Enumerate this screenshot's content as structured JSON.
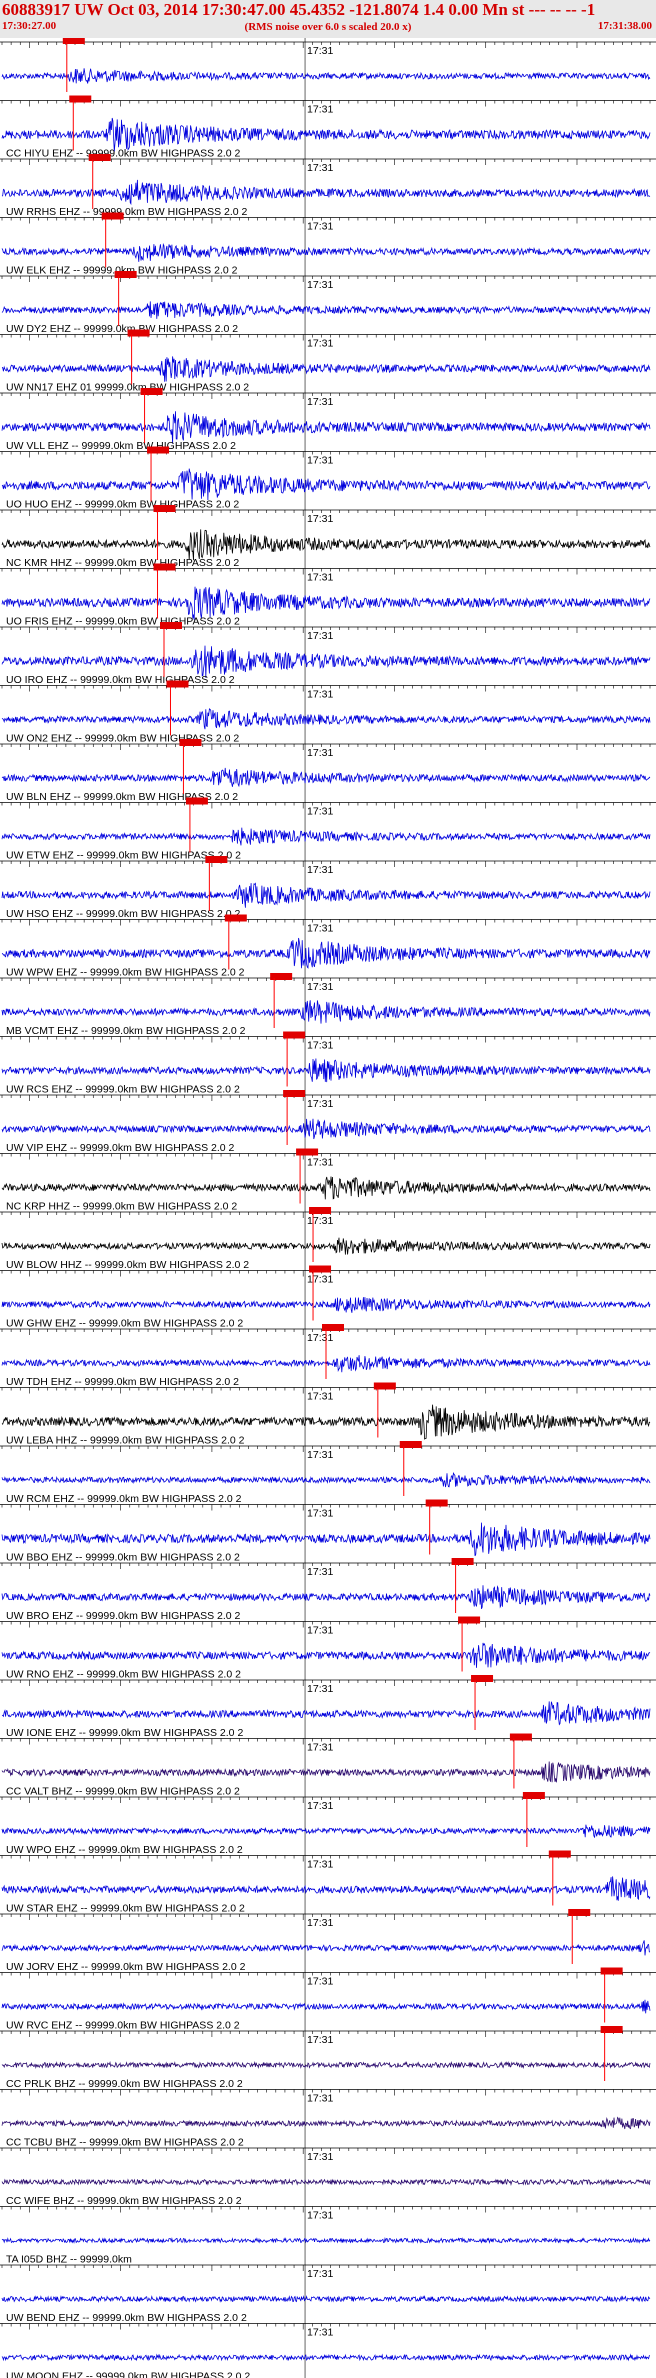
{
  "header": {
    "title": "60883917 UW Oct 03, 2014 17:30:47.00   45.4352 -121.8074  1.4 0.00 Mn st --- -- --  -1",
    "start_time": "17:30:27.00",
    "scale_note": "(RMS noise over 6.0 s scaled 20.0 x)",
    "end_time": "17:31:38.00"
  },
  "minute_label": "17:31",
  "colors": {
    "header_text": "#d40000",
    "header_bg": "#e8e8e8",
    "pick_line": "#ff0000",
    "pick_box": "#e00000"
  },
  "traces": [
    {
      "label": "",
      "color": "#0000dd",
      "burst": 0.1,
      "amp": 0.35
    },
    {
      "label": "CC HIYU EHZ -- 99999.0km BW  HIGHPASS  2.0  2",
      "color": "#0000dd",
      "burst": 0.16,
      "amp": 0.9
    },
    {
      "label": "UW RRHS EHZ -- 99999.0km BW  HIGHPASS  2.0  2",
      "color": "#0000dd",
      "burst": 0.18,
      "amp": 0.7
    },
    {
      "label": "UW ELK EHZ -- 99999.0km BW  HIGHPASS  2.0  2",
      "color": "#0000dd",
      "burst": 0.2,
      "amp": 0.45
    },
    {
      "label": "UW DY2 EHZ -- 99999.0km BW  HIGHPASS  2.0  2",
      "color": "#0000dd",
      "burst": 0.22,
      "amp": 0.45
    },
    {
      "label": "UW NN17 EHZ 01 99999.0km BW  HIGHPASS  2.0  2",
      "color": "#0000dd",
      "burst": 0.24,
      "amp": 0.6
    },
    {
      "label": "UW VLL EHZ -- 99999.0km BW  HIGHPASS  2.0  2",
      "color": "#0000dd",
      "burst": 0.25,
      "amp": 0.8
    },
    {
      "label": "UO HUO EHZ -- 99999.0km BW  HIGHPASS  2.0  2",
      "color": "#0000dd",
      "burst": 0.27,
      "amp": 0.9
    },
    {
      "label": "NC KMR HHZ -- 99999.0km BW  HIGHPASS  2.0  2",
      "color": "#000000",
      "burst": 0.28,
      "amp": 0.8
    },
    {
      "label": "UO FRIS EHZ -- 99999.0km BW  HIGHPASS  2.0  2",
      "color": "#0000dd",
      "burst": 0.28,
      "amp": 0.9
    },
    {
      "label": "UO IRO EHZ -- 99999.0km BW  HIGHPASS  2.0  2",
      "color": "#0000dd",
      "burst": 0.29,
      "amp": 0.9
    },
    {
      "label": "UW ON2 EHZ -- 99999.0km BW  HIGHPASS  2.0  2",
      "color": "#0000dd",
      "burst": 0.3,
      "amp": 0.5
    },
    {
      "label": "UW BLN EHZ -- 99999.0km BW  HIGHPASS  2.0  2",
      "color": "#0000dd",
      "burst": 0.32,
      "amp": 0.5
    },
    {
      "label": "UW ETW EHZ -- 99999.0km BW  HIGHPASS  2.0  2",
      "color": "#0000dd",
      "burst": 0.35,
      "amp": 0.4
    },
    {
      "label": "UW HSO EHZ -- 99999.0km BW  HIGHPASS  2.0  2",
      "color": "#0000dd",
      "burst": 0.36,
      "amp": 0.6
    },
    {
      "label": "UW WPW EHZ -- 99999.0km BW  HIGHPASS  2.0  2",
      "color": "#0000dd",
      "burst": 0.44,
      "amp": 0.8
    },
    {
      "label": "MB VCMT EHZ -- 99999.0km BW  HIGHPASS  2.0  2",
      "color": "#0000dd",
      "burst": 0.46,
      "amp": 0.6
    },
    {
      "label": "UW RCS EHZ -- 99999.0km BW  HIGHPASS  2.0  2",
      "color": "#0000dd",
      "burst": 0.47,
      "amp": 0.6
    },
    {
      "label": "UW VIP EHZ -- 99999.0km BW  HIGHPASS  2.0  2",
      "color": "#0000dd",
      "burst": 0.46,
      "amp": 0.5
    },
    {
      "label": "NC KRP HHZ -- 99999.0km BW  HIGHPASS  2.0  2",
      "color": "#000000",
      "burst": 0.49,
      "amp": 0.6
    },
    {
      "label": "UW BLOW HHZ -- 99999.0km BW  HIGHPASS  2.0  2",
      "color": "#000000",
      "burst": 0.51,
      "amp": 0.4
    },
    {
      "label": "UW GHW EHZ -- 99999.0km BW  HIGHPASS  2.0  2",
      "color": "#0000dd",
      "burst": 0.51,
      "amp": 0.4
    },
    {
      "label": "UW TDH EHZ -- 99999.0km BW  HIGHPASS  2.0  2",
      "color": "#0000dd",
      "burst": 0.51,
      "amp": 0.4
    },
    {
      "label": "UW LEBA HHZ -- 99999.0km BW  HIGHPASS  2.0  2",
      "color": "#000000",
      "burst": 0.64,
      "amp": 0.9
    },
    {
      "label": "UW RCM EHZ -- 99999.0km BW  HIGHPASS  2.0  2",
      "color": "#0000dd",
      "burst": 0.67,
      "amp": 0.3
    },
    {
      "label": "UW BBO EHZ -- 99999.0km BW  HIGHPASS  2.0  2",
      "color": "#0000dd",
      "burst": 0.72,
      "amp": 0.9
    },
    {
      "label": "UW BRO EHZ -- 99999.0km BW  HIGHPASS  2.0  2",
      "color": "#0000dd",
      "burst": 0.72,
      "amp": 0.6
    },
    {
      "label": "UW RNO EHZ -- 99999.0km BW  HIGHPASS  2.0  2",
      "color": "#0000dd",
      "burst": 0.72,
      "amp": 0.7
    },
    {
      "label": "UW IONE EHZ -- 99999.0km BW  HIGHPASS  2.0  2",
      "color": "#0000dd",
      "burst": 0.83,
      "amp": 0.6
    },
    {
      "label": "CC VALT BHZ -- 99999.0km BW  HIGHPASS  2.0  2",
      "color": "#2a0a6e",
      "burst": 0.83,
      "amp": 0.5
    },
    {
      "label": "UW WPO EHZ -- 99999.0km BW  HIGHPASS  2.0  2",
      "color": "#0000dd",
      "burst": 0.89,
      "amp": 0.3
    },
    {
      "label": "UW STAR EHZ -- 99999.0km BW  HIGHPASS  2.0  2",
      "color": "#0000dd",
      "burst": 0.93,
      "amp": 0.6
    },
    {
      "label": "UW JORV EHZ -- 99999.0km BW  HIGHPASS  2.0  2",
      "color": "#0000dd",
      "burst": 0.98,
      "amp": 0.3
    },
    {
      "label": "UW RVC EHZ -- 99999.0km BW  HIGHPASS  2.0  2",
      "color": "#0000dd",
      "burst": 0.98,
      "amp": 0.3
    },
    {
      "label": "CC PRLK BHZ -- 99999.0km BW  HIGHPASS  2.0  2",
      "color": "#2a0a6e",
      "burst": -1,
      "amp": 0.2
    },
    {
      "label": "CC TCBU BHZ -- 99999.0km BW  HIGHPASS  2.0  2",
      "color": "#2a0a6e",
      "burst": 0.92,
      "amp": 0.25
    },
    {
      "label": "CC WIFE BHZ -- 99999.0km BW  HIGHPASS  2.0  2",
      "color": "#2a0a6e",
      "burst": -1,
      "amp": 0.15
    },
    {
      "label": "TA I05D BHZ -- 99999.0km",
      "color": "#0000dd",
      "burst": -1,
      "amp": 0.0
    },
    {
      "label": "UW BEND EHZ -- 99999.0km BW  HIGHPASS  2.0  2",
      "color": "#0000dd",
      "burst": -1,
      "amp": 0.2
    },
    {
      "label": "UW MOON EHZ -- 99999.0km BW  HIGHPASS  2.0  2",
      "color": "#0000dd",
      "burst": -1,
      "amp": 0.2
    }
  ],
  "picks": [
    0.1,
    0.11,
    0.14,
    0.16,
    0.18,
    0.2,
    0.22,
    0.23,
    0.24,
    0.24,
    0.25,
    0.26,
    0.28,
    0.29,
    0.32,
    0.35,
    0.42,
    0.44,
    0.44,
    0.46,
    0.48,
    0.48,
    0.5,
    0.58,
    0.62,
    0.66,
    0.7,
    0.71,
    0.73,
    0.79,
    0.81,
    0.85,
    0.88,
    0.93,
    0.93
  ]
}
